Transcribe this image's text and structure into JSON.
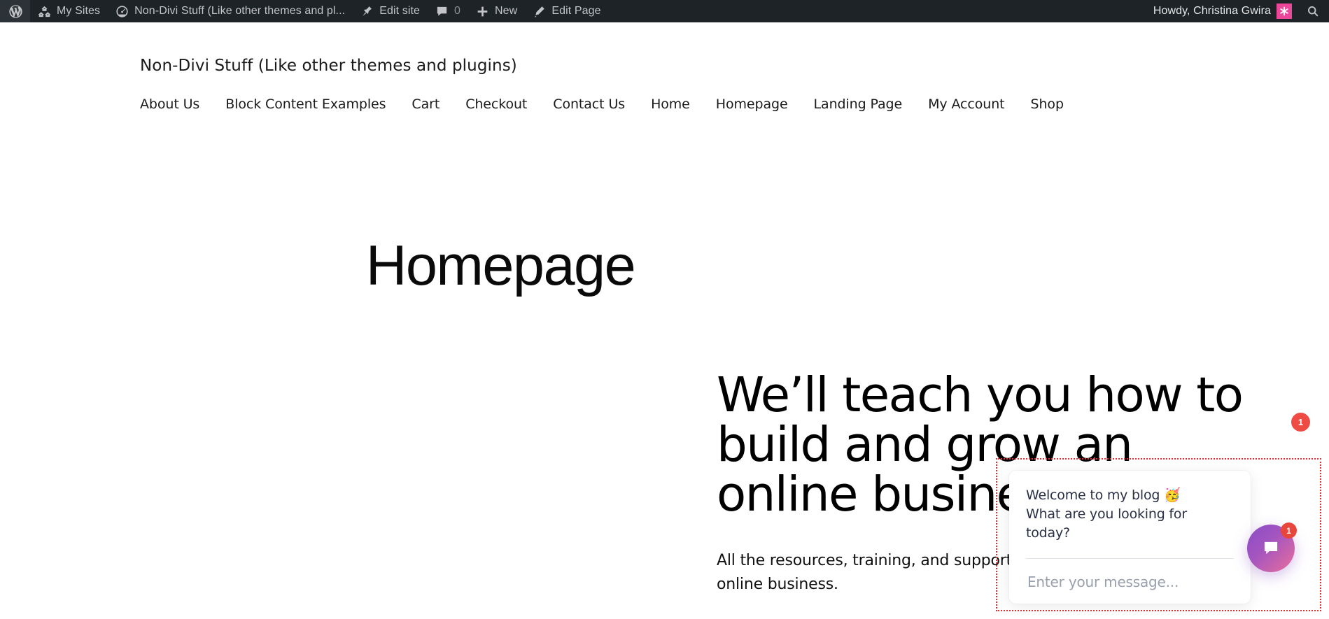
{
  "adminbar": {
    "wp_logo": "wordpress-logo-icon",
    "items": [
      {
        "id": "my-sites",
        "label": "My Sites",
        "icon": "network-sites-icon"
      },
      {
        "id": "site-name",
        "label": "Non-Divi Stuff (Like other themes and pl...",
        "icon": "dashboard-gauge-icon"
      },
      {
        "id": "edit-site",
        "label": "Edit site",
        "icon": "pin-tack-icon"
      },
      {
        "id": "comments",
        "label": "0",
        "icon": "comment-bubble-icon"
      },
      {
        "id": "new",
        "label": "New",
        "icon": "plus-icon"
      },
      {
        "id": "edit-page",
        "label": "Edit Page",
        "icon": "pencil-icon"
      }
    ],
    "howdy": "Howdy, Christina Gwira",
    "avatar_icon": "avatar-asterisk-icon",
    "avatar_color": "#ec4899",
    "search_icon": "search-icon",
    "bar_color": "#1d2327"
  },
  "site": {
    "title": "Non-Divi Stuff (Like other themes and plugins)",
    "nav": [
      {
        "label": "About Us"
      },
      {
        "label": "Block Content Examples"
      },
      {
        "label": "Cart"
      },
      {
        "label": "Checkout"
      },
      {
        "label": "Contact Us"
      },
      {
        "label": "Home"
      },
      {
        "label": "Homepage"
      },
      {
        "label": "Landing Page"
      },
      {
        "label": "My Account"
      },
      {
        "label": "Shop"
      }
    ]
  },
  "page": {
    "title": "Homepage",
    "hero_heading": "We’ll teach you how to build and grow an online business.",
    "hero_paragraph": "All the resources, training, and support you need to run your dream online business."
  },
  "chat": {
    "greeting": "Welcome to my blog 🥳\nWhat are you looking for today?",
    "input_value": "",
    "input_placeholder": "Enter your message...",
    "launcher_icon": "chat-bubble-icon",
    "launcher_badge": "1",
    "launcher_gradient_from": "#8a4cc6",
    "launcher_gradient_to": "#ea6e9c",
    "notice_badge": "1",
    "notice_badge_color": "#ef4b45",
    "highlight_border_color": "#e03131"
  }
}
